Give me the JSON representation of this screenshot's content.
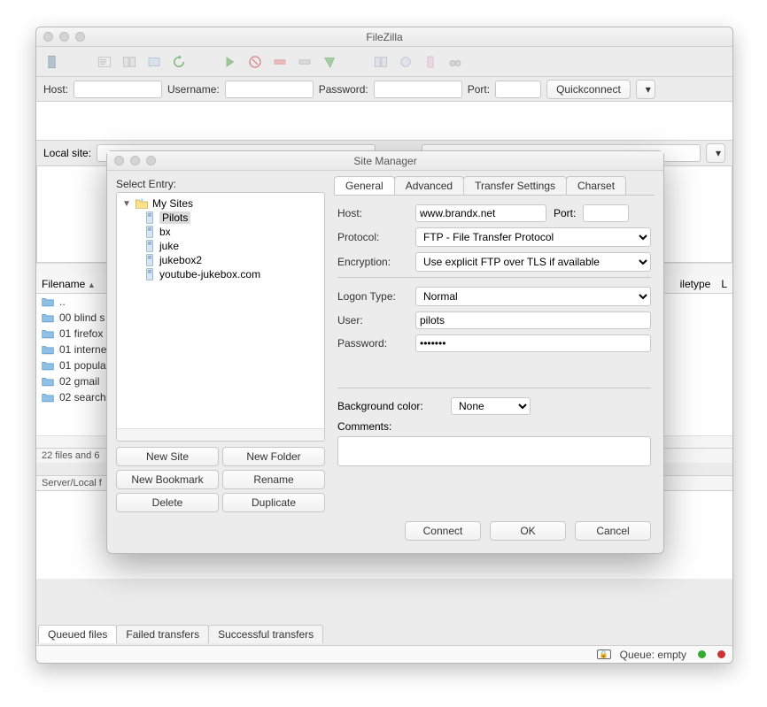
{
  "window": {
    "title": "FileZilla"
  },
  "quickconnect": {
    "host_label": "Host:",
    "user_label": "Username:",
    "pass_label": "Password:",
    "port_label": "Port:",
    "button": "Quickconnect"
  },
  "local": {
    "site_label": "Local site:",
    "filename_header": "Filename",
    "filetype_header": "iletype",
    "last_col_fragment": "L",
    "rows": [
      "..",
      "00 blind s",
      "01 firefox",
      "01 interne",
      "01 popula",
      "02 gmail ",
      "02 search"
    ],
    "status": "22 files and 6",
    "server_status": "Server/Local f"
  },
  "bottom_tabs": [
    "Queued files",
    "Failed transfers",
    "Successful transfers"
  ],
  "statusbar": {
    "queue": "Queue: empty"
  },
  "site_manager": {
    "title": "Site Manager",
    "select_label": "Select Entry:",
    "root": "My Sites",
    "sites": [
      "Pilots",
      "bx",
      "juke",
      "jukebox2",
      "youtube-jukebox.com"
    ],
    "selected_index": 0,
    "buttons": {
      "new_site": "New Site",
      "new_folder": "New Folder",
      "new_bookmark": "New Bookmark",
      "rename": "Rename",
      "delete": "Delete",
      "duplicate": "Duplicate"
    },
    "tabs": [
      "General",
      "Advanced",
      "Transfer Settings",
      "Charset"
    ],
    "active_tab": 0,
    "form": {
      "host_label": "Host:",
      "host": "www.brandx.net",
      "port_label": "Port:",
      "port": "",
      "protocol_label": "Protocol:",
      "protocol": "FTP - File Transfer Protocol",
      "encryption_label": "Encryption:",
      "encryption": "Use explicit FTP over TLS if available",
      "logon_type_label": "Logon Type:",
      "logon_type": "Normal",
      "user_label": "User:",
      "user": "pilots",
      "password_label": "Password:",
      "password": "•••••••",
      "bg_label": "Background color:",
      "bg": "None",
      "comments_label": "Comments:",
      "comments": ""
    },
    "footer": {
      "connect": "Connect",
      "ok": "OK",
      "cancel": "Cancel"
    }
  }
}
